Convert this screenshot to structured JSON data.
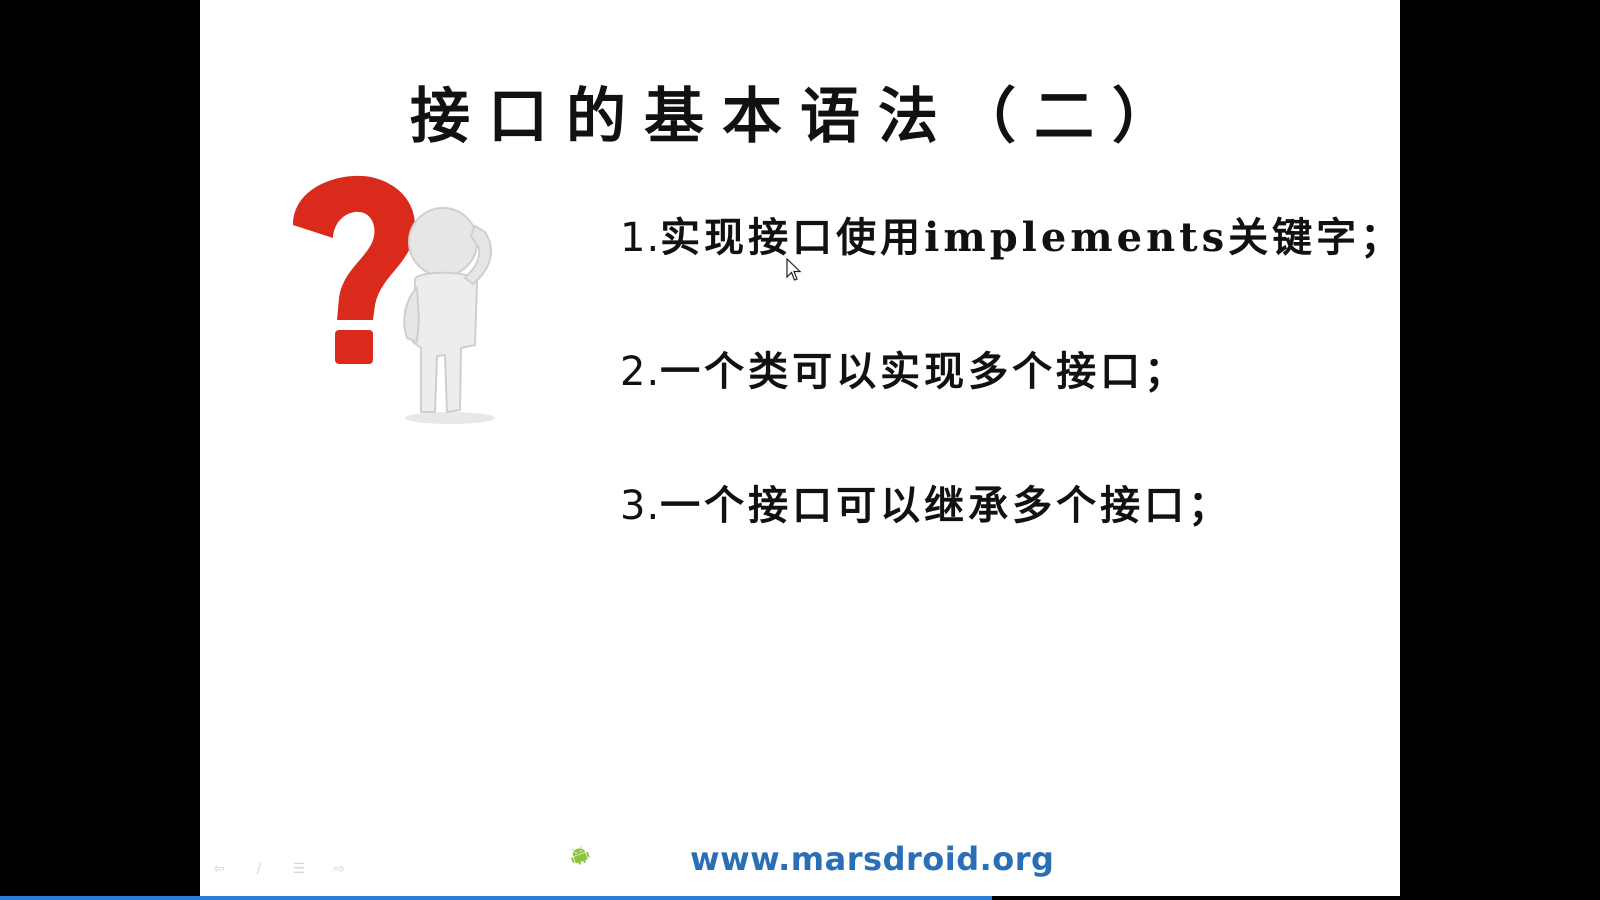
{
  "slide": {
    "title": "接口的基本语法（二）",
    "bullets": [
      {
        "number": "1.",
        "text": "实现接口使用implements关键字；"
      },
      {
        "number": "2.",
        "text": "一个类可以实现多个接口；"
      },
      {
        "number": "3.",
        "text": "一个接口可以继承多个接口；"
      }
    ],
    "illustration_icon": "question-mark-figure-icon",
    "footer": {
      "logo_icon": "android-robot-icon",
      "url": "www.marsdroid.org"
    }
  },
  "player": {
    "progress": 0.62,
    "controls": [
      "previous-icon",
      "pen-icon",
      "menu-icon",
      "next-icon"
    ]
  },
  "colors": {
    "background": "#000000",
    "slide": "#ffffff",
    "title_text": "#111111",
    "url_text": "#2a6fb5",
    "question_mark": "#d92a1c",
    "android_green": "#8cc63f",
    "progress": "#2b7fd6"
  }
}
